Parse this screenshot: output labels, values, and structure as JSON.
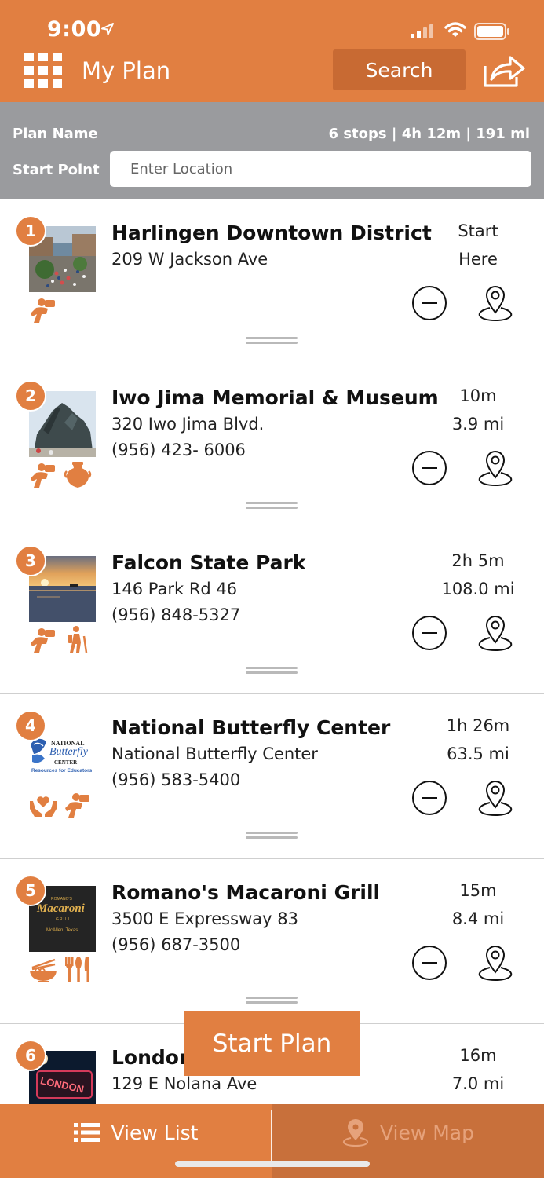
{
  "status_bar": {
    "time": "9:00"
  },
  "header": {
    "title": "My Plan",
    "search_label": "Search"
  },
  "plan": {
    "name_label": "Plan Name",
    "summary": "6 stops | 4h 12m | 191 mi",
    "start_label": "Start Point",
    "start_placeholder": "Enter Location"
  },
  "stops": [
    {
      "number": "1",
      "name": "Harlingen Downtown District",
      "address": "209 W Jackson Ave",
      "phone": "",
      "time": "Start",
      "distance": "Here",
      "categories": [
        "photo-icon"
      ]
    },
    {
      "number": "2",
      "name": "Iwo Jima Memorial & Museum",
      "address": "320 Iwo Jima Blvd.",
      "phone": "(956) 423- 6006",
      "time": "10m",
      "distance": "3.9 mi",
      "categories": [
        "photo-icon",
        "vase-icon"
      ]
    },
    {
      "number": "3",
      "name": "Falcon State Park",
      "address": "146 Park Rd 46",
      "phone": "(956) 848-5327",
      "time": "2h 5m",
      "distance": "108.0 mi",
      "categories": [
        "photo-icon",
        "hiker-icon"
      ]
    },
    {
      "number": "4",
      "name": "National Butterfly Center",
      "address": "National Butterfly Center",
      "phone": "(956) 583-5400",
      "time": "1h 26m",
      "distance": "63.5 mi",
      "categories": [
        "heart-hands-icon",
        "photo-icon"
      ]
    },
    {
      "number": "5",
      "name": "Romano's Macaroni Grill",
      "address": "3500 E Expressway 83",
      "phone": "(956) 687-3500",
      "time": "15m",
      "distance": "8.4 mi",
      "categories": [
        "noodle-bowl-icon",
        "utensils-icon"
      ]
    },
    {
      "number": "6",
      "name": "London",
      "address": "129 E Nolana Ave",
      "phone": "",
      "time": "16m",
      "distance": "7.0 mi",
      "categories": []
    }
  ],
  "thumb_text": {
    "butterfly_line1": "NATIONAL",
    "butterfly_line2": "Butterfly",
    "butterfly_line3": "CENTER",
    "butterfly_line4": "Resources for Educators",
    "macaroni_small": "ROMANO'S",
    "macaroni_main": "Macaroni",
    "macaroni_grill": "GRILL",
    "macaroni_city": "McAllen, Texas",
    "london": "LONDON"
  },
  "start_plan_label": "Start Plan",
  "tabs": {
    "list_label": "View List",
    "map_label": "View Map"
  },
  "colors": {
    "accent": "#E17F41",
    "accent_dark": "#C86A33",
    "plan_bar": "#9A9B9E"
  }
}
